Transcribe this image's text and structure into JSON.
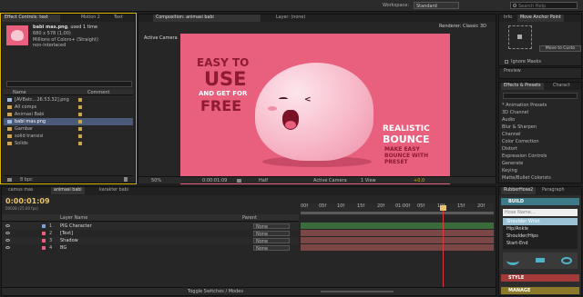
{
  "menu": {
    "workspace_label": "Workspace:",
    "workspace_value": "Standard",
    "search_placeholder": "Search Help"
  },
  "project": {
    "tabs": [
      "Effect Controls: text",
      "Motion 2",
      "Text"
    ],
    "item_name": "babi mas.png",
    "item_used": ", used 1 time",
    "item_dims": "680 x 578 (1,00)",
    "item_color": "Millions of Colors+ (Straight)",
    "item_interlace": "non-interlaced",
    "col_name": "Name",
    "col_comment": "Comment",
    "items": [
      "[AVBatc...26.53.32].png",
      "All comps",
      "Animasi Babi",
      "babi mas.png",
      "Gambar",
      "solid transisi",
      "Solids"
    ],
    "footer_bpc": "8 bpc"
  },
  "comp": {
    "tabs": [
      "Composition: animasi babi",
      "Layer: (none)"
    ],
    "active_camera": "Active Camera",
    "renderer": "Renderer: Classic 3D",
    "canvas": {
      "easy1": "EASY TO",
      "easy2": "USE",
      "easy3": "AND GET FOR",
      "easy4": "FREE",
      "real1": "REALISTIC",
      "real2": "BOUNCE",
      "real3": "MAKE EASY",
      "real4": "BOUNCE WITH",
      "real5": "PRESET",
      "bg_color": "#e8607e"
    },
    "footer": {
      "zoom": "50%",
      "time": "0:00:01:09",
      "res": "Half",
      "camera": "Active Camera",
      "view": "1 View",
      "exposure": "+0,0"
    }
  },
  "info": {
    "tabs": [
      "Info",
      "Move Anchor Point"
    ],
    "move_button": "Move to Custo",
    "ignore_masks": "Ignore Masks",
    "preview_tab": "Preview"
  },
  "effects": {
    "tabs": [
      "Effects & Presets",
      "Charact"
    ],
    "items": [
      "* Animation Presets",
      "3D Channel",
      "Audio",
      "Blur & Sharpen",
      "Channel",
      "Color Correction",
      "Distort",
      "Expression Controls",
      "Generate",
      "Keying",
      "Matte/Bullet Colorists"
    ]
  },
  "timeline": {
    "tabs": [
      "camus mas",
      "animasi babi",
      "karakter babi"
    ],
    "timecode": "0:00:01:09",
    "frame_info": "00028 (25.00 fps)",
    "col_layer": "Layer Name",
    "col_parent": "Parent",
    "layers": [
      {
        "num": "1",
        "name": "PIG Character",
        "parent": "None",
        "color": "#7aa2d6"
      },
      {
        "num": "2",
        "name": "[Text]",
        "parent": "None",
        "color": "#e8607e"
      },
      {
        "num": "3",
        "name": "Shadow",
        "parent": "None",
        "color": "#e8607e"
      },
      {
        "num": "4",
        "name": "BG",
        "parent": "None",
        "color": "#e8607e"
      }
    ],
    "ruler": [
      "00f",
      "05f",
      "10f",
      "15f",
      "20f",
      "01:00f",
      "05f",
      "10f",
      "15f",
      "20f"
    ],
    "footer": "Toggle Switches / Modes"
  },
  "rubber": {
    "tabs": [
      "RubberHose2",
      "Paragraph"
    ],
    "build": "BUILD",
    "placeholder": "Hose Name...",
    "hoses": [
      "Shoulder Wrist",
      "Hip/Ankle",
      "Shoulder/Hips",
      "Start-End"
    ],
    "style": "STYLE",
    "manage": "MANAGE"
  }
}
